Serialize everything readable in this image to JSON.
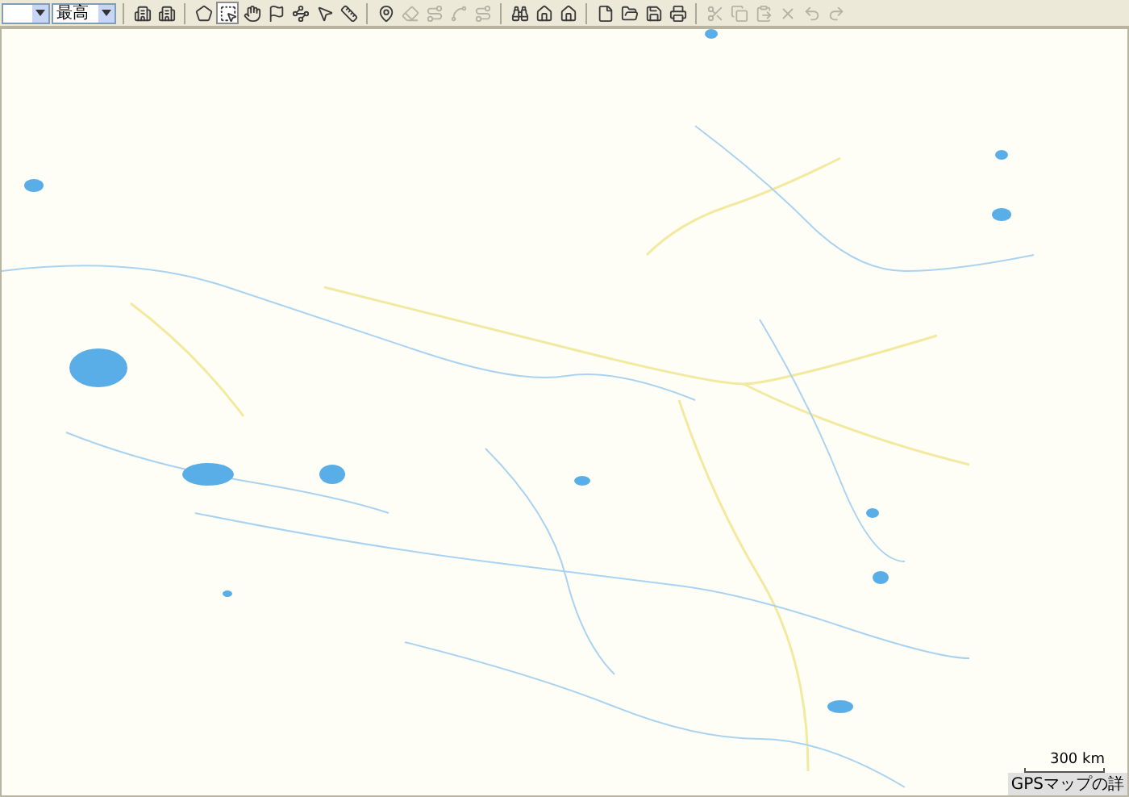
{
  "toolbar": {
    "quality_dropdown": {
      "value": "最高"
    },
    "groups": [
      [
        {
          "kind": "building",
          "disabled": false
        },
        {
          "kind": "building",
          "disabled": false
        }
      ],
      [
        {
          "kind": "polygon",
          "disabled": false,
          "selected": false
        },
        {
          "kind": "select",
          "disabled": false,
          "selected": true
        },
        {
          "kind": "hand",
          "disabled": false,
          "selected": false
        },
        {
          "kind": "flag",
          "disabled": false,
          "selected": false
        },
        {
          "kind": "nodes",
          "disabled": false,
          "selected": false
        },
        {
          "kind": "pointer",
          "disabled": false,
          "selected": false
        },
        {
          "kind": "ruler",
          "disabled": false,
          "selected": false
        }
      ],
      [
        {
          "kind": "pin",
          "disabled": false
        },
        {
          "kind": "eraser",
          "disabled": true
        },
        {
          "kind": "route",
          "disabled": true
        },
        {
          "kind": "spline",
          "disabled": true
        },
        {
          "kind": "route",
          "disabled": true
        }
      ],
      [
        {
          "kind": "binoculars",
          "disabled": false
        },
        {
          "kind": "home",
          "disabled": false
        },
        {
          "kind": "home",
          "disabled": false
        }
      ],
      [
        {
          "kind": "new",
          "disabled": false
        },
        {
          "kind": "open",
          "disabled": false
        },
        {
          "kind": "save",
          "disabled": false
        },
        {
          "kind": "print",
          "disabled": false
        }
      ],
      [
        {
          "kind": "cut",
          "disabled": true
        },
        {
          "kind": "copy",
          "disabled": true
        },
        {
          "kind": "paste",
          "disabled": true
        },
        {
          "kind": "delete",
          "disabled": true
        },
        {
          "kind": "undo",
          "disabled": true
        },
        {
          "kind": "redo",
          "disabled": true
        }
      ]
    ]
  },
  "map": {
    "scale": "300 km",
    "footer": "GPSマップの詳"
  }
}
